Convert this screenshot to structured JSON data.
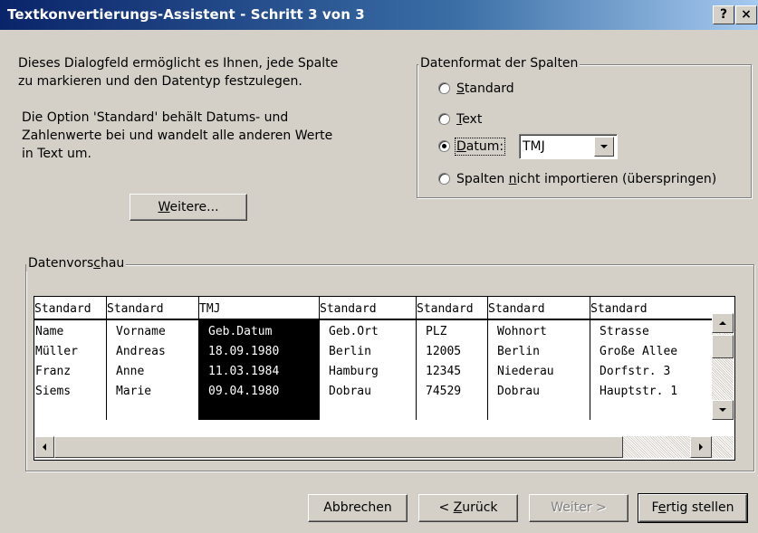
{
  "window": {
    "title": "Textkonvertierungs-Assistent - Schritt 3 von 3",
    "help_label": "?",
    "close_label": "×"
  },
  "description": {
    "line1": "Dieses Dialogfeld ermöglicht es Ihnen, jede Spalte",
    "line2": "zu markieren und den Datentyp festzulegen.",
    "line3": "Die Option 'Standard' behält Datums- und",
    "line4": "Zahlenwerte bei und wandelt alle anderen Werte",
    "line5": "in Text um."
  },
  "weitere_button": {
    "accel": "W",
    "rest": "eitere..."
  },
  "format_group": {
    "label": "Datenformat der Spalten",
    "options": [
      {
        "accel": "S",
        "rest": "tandard",
        "selected": false
      },
      {
        "accel": "T",
        "rest": "ext",
        "selected": false
      },
      {
        "accel": "D",
        "rest": "atum:",
        "selected": true
      },
      {
        "pre": "Spalten ",
        "accel": "n",
        "rest": "icht importieren (überspringen)",
        "selected": false
      }
    ],
    "date_format_value": "TMJ"
  },
  "preview": {
    "label_pre": "Datenvors",
    "label_accel": "c",
    "label_post": "hau",
    "headers": [
      "Standard",
      "Standard",
      "TMJ",
      "Standard",
      "Standard",
      "Standard",
      "Standard"
    ],
    "rows": [
      [
        "Name",
        "Vorname",
        "Geb.Datum",
        "Geb.Ort",
        "PLZ",
        "Wohnort",
        "Strasse"
      ],
      [
        "Müller",
        "Andreas",
        "18.09.1980",
        "Berlin",
        "12005",
        "Berlin",
        "Große Allee"
      ],
      [
        "Franz",
        "Anne",
        "11.03.1984",
        "Hamburg",
        "12345",
        "Niederau",
        "Dorfstr. 3"
      ],
      [
        "Siems",
        "Marie",
        "09.04.1980",
        "Dobrau",
        "74529",
        "Dobrau",
        "Hauptstr. 1"
      ]
    ],
    "selected_column": 2
  },
  "buttons": {
    "cancel": "Abbrechen",
    "back_pre": "< ",
    "back_accel": "Z",
    "back_rest": "urück",
    "next": "Weiter >",
    "finish_pre": "F",
    "finish_accel": "e",
    "finish_rest": "rtig stellen"
  },
  "colors": {
    "title_bar": "#0a246a",
    "face": "#d4d0c8",
    "selected_column": "#000000"
  }
}
